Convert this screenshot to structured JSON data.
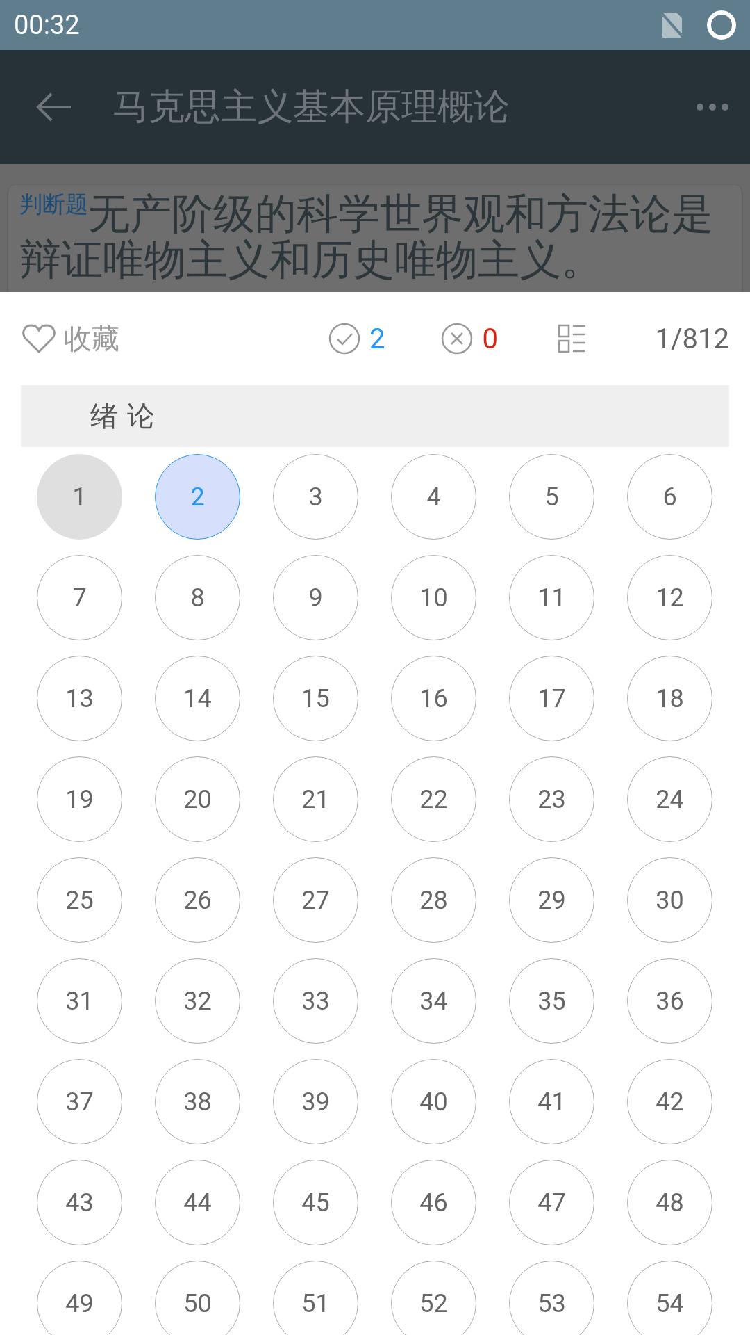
{
  "status_bar": {
    "time": "00:32"
  },
  "app_bar": {
    "title": "马克思主义基本原理概论"
  },
  "question": {
    "type_label": "判断题",
    "text": "无产阶级的科学世界观和方法论是辩证唯物主义和历史唯物主义。"
  },
  "sheet": {
    "favorite": {
      "label": "收藏",
      "checked": false
    },
    "correct_count": "2",
    "wrong_count": "0",
    "progress": "1/812",
    "section": {
      "title": "绪 论"
    },
    "questions": [
      {
        "number": "1",
        "kind": "done"
      },
      {
        "number": "2",
        "kind": "current"
      },
      {
        "number": "3",
        "kind": "open"
      },
      {
        "number": "4",
        "kind": "open"
      },
      {
        "number": "5",
        "kind": "open"
      },
      {
        "number": "6",
        "kind": "open"
      },
      {
        "number": "7",
        "kind": "open"
      },
      {
        "number": "8",
        "kind": "open"
      },
      {
        "number": "9",
        "kind": "open"
      },
      {
        "number": "10",
        "kind": "open"
      },
      {
        "number": "11",
        "kind": "open"
      },
      {
        "number": "12",
        "kind": "open"
      },
      {
        "number": "13",
        "kind": "open"
      },
      {
        "number": "14",
        "kind": "open"
      },
      {
        "number": "15",
        "kind": "open"
      },
      {
        "number": "16",
        "kind": "open"
      },
      {
        "number": "17",
        "kind": "open"
      },
      {
        "number": "18",
        "kind": "open"
      },
      {
        "number": "19",
        "kind": "open"
      },
      {
        "number": "20",
        "kind": "open"
      },
      {
        "number": "21",
        "kind": "open"
      },
      {
        "number": "22",
        "kind": "open"
      },
      {
        "number": "23",
        "kind": "open"
      },
      {
        "number": "24",
        "kind": "open"
      },
      {
        "number": "25",
        "kind": "open"
      },
      {
        "number": "26",
        "kind": "open"
      },
      {
        "number": "27",
        "kind": "open"
      },
      {
        "number": "28",
        "kind": "open"
      },
      {
        "number": "29",
        "kind": "open"
      },
      {
        "number": "30",
        "kind": "open"
      },
      {
        "number": "31",
        "kind": "open"
      },
      {
        "number": "32",
        "kind": "open"
      },
      {
        "number": "33",
        "kind": "open"
      },
      {
        "number": "34",
        "kind": "open"
      },
      {
        "number": "35",
        "kind": "open"
      },
      {
        "number": "36",
        "kind": "open"
      },
      {
        "number": "37",
        "kind": "open"
      },
      {
        "number": "38",
        "kind": "open"
      },
      {
        "number": "39",
        "kind": "open"
      },
      {
        "number": "40",
        "kind": "open"
      },
      {
        "number": "41",
        "kind": "open"
      },
      {
        "number": "42",
        "kind": "open"
      },
      {
        "number": "43",
        "kind": "open"
      },
      {
        "number": "44",
        "kind": "open"
      },
      {
        "number": "45",
        "kind": "open"
      },
      {
        "number": "46",
        "kind": "open"
      },
      {
        "number": "47",
        "kind": "open"
      },
      {
        "number": "48",
        "kind": "open"
      },
      {
        "number": "49",
        "kind": "open"
      },
      {
        "number": "50",
        "kind": "open"
      },
      {
        "number": "51",
        "kind": "open"
      },
      {
        "number": "52",
        "kind": "open"
      },
      {
        "number": "53",
        "kind": "open"
      },
      {
        "number": "54",
        "kind": "open"
      }
    ]
  }
}
